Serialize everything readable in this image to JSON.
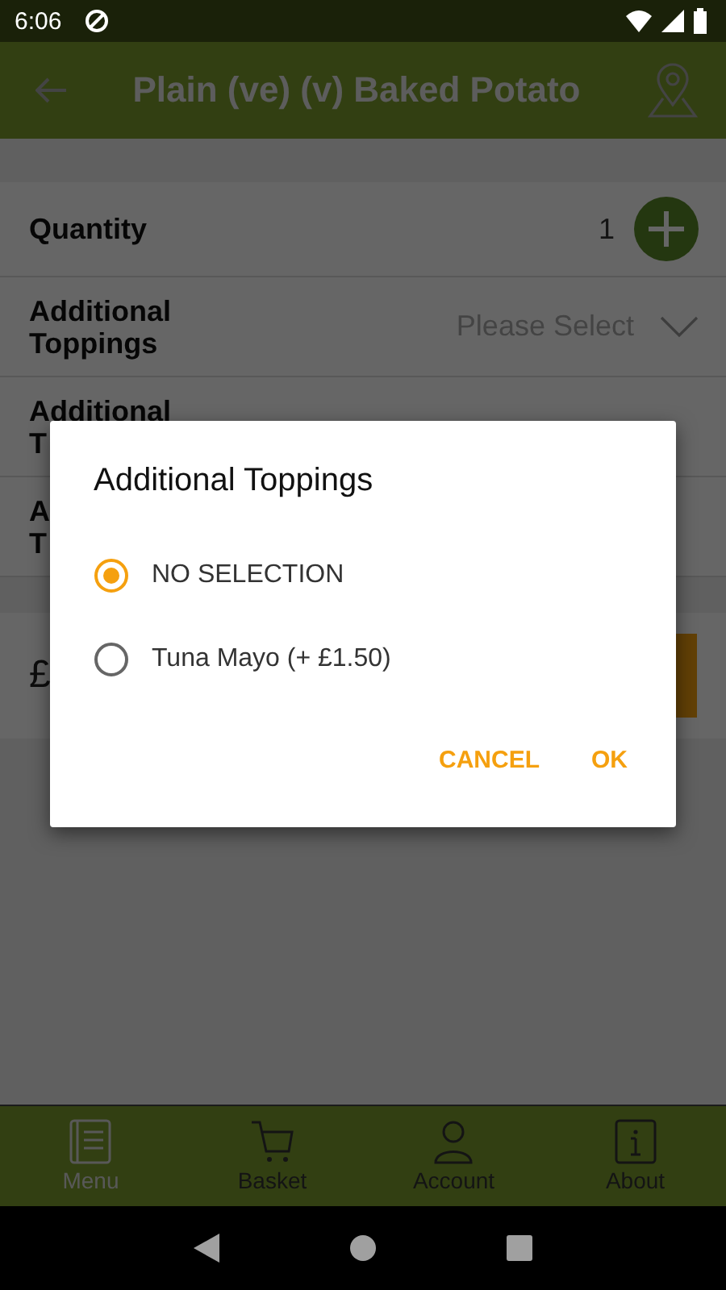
{
  "status_bar": {
    "time": "6:06"
  },
  "header": {
    "title": "Plain (ve) (v) Baked Potato"
  },
  "quantity": {
    "label": "Quantity",
    "value": "1"
  },
  "options": [
    {
      "label_lines": [
        "Additional",
        "Toppings"
      ],
      "value": "Please Select"
    },
    {
      "label_lines": [
        "Additional",
        "T"
      ]
    },
    {
      "label_lines": [
        "A",
        "T"
      ]
    }
  ],
  "price": {
    "text": "£"
  },
  "dialog": {
    "title": "Additional Toppings",
    "choices": [
      {
        "label": "NO SELECTION",
        "selected": true
      },
      {
        "label": "Tuna Mayo (+ £1.50)",
        "selected": false
      }
    ],
    "buttons": [
      "CANCEL",
      "OK"
    ]
  },
  "bottom_nav": [
    {
      "label": "Menu",
      "kind": "book",
      "selected": true
    },
    {
      "label": "Basket",
      "kind": "cart",
      "selected": false
    },
    {
      "label": "Account",
      "kind": "person",
      "selected": false
    },
    {
      "label": "About",
      "kind": "info",
      "selected": false
    }
  ]
}
